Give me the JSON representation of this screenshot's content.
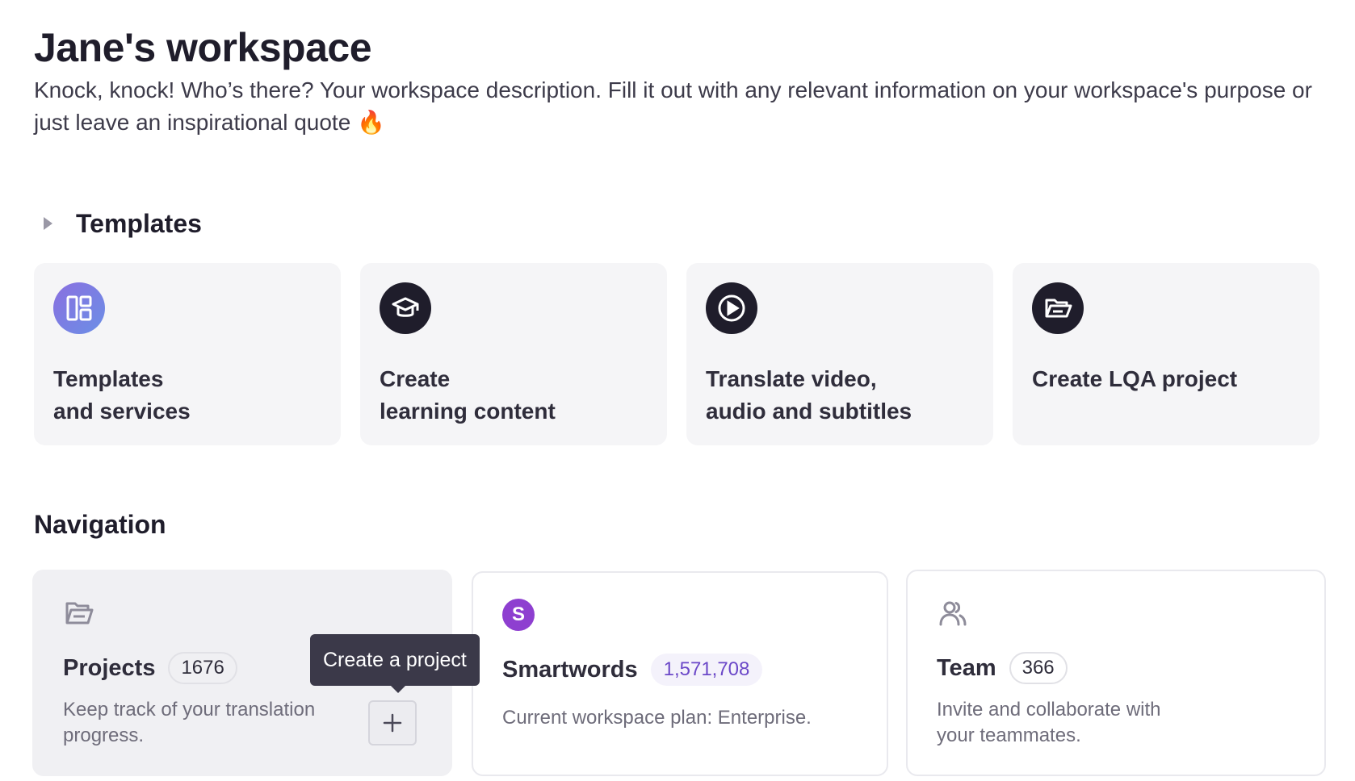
{
  "workspace": {
    "title": "Jane's workspace",
    "description": "Knock, knock! Who’s there? Your workspace description. Fill it out with any relevant information on your workspace's purpose or just leave an inspirational quote 🔥"
  },
  "templates": {
    "section_title": "Templates",
    "caret_icon": "caret-right-icon",
    "items": [
      {
        "line1": "Templates",
        "line2": "and services",
        "icon": "layout-grid-icon"
      },
      {
        "line1": "Create",
        "line2": "learning content",
        "icon": "graduation-cap-icon"
      },
      {
        "line1": "Translate video,",
        "line2": "audio and subtitles",
        "icon": "play-circle-icon"
      },
      {
        "line1": "Create LQA project",
        "line2": "",
        "icon": "folder-open-icon"
      }
    ]
  },
  "navigation": {
    "section_title": "Navigation",
    "projects": {
      "name": "Projects",
      "count": "1676",
      "desc_line1": "Keep track of your translation",
      "desc_line2": "progress.",
      "icon": "folder-open-icon",
      "add_icon": "plus-icon",
      "tooltip": "Create a project"
    },
    "smartwords": {
      "avatar_letter": "S",
      "name": "Smartwords",
      "count": "1,571,708",
      "desc": "Current workspace plan: Enterprise."
    },
    "team": {
      "name": "Team",
      "count": "366",
      "desc_line1": "Invite and collaborate with",
      "desc_line2": "your teammates.",
      "icon": "users-icon"
    }
  },
  "colors": {
    "accent_purple": "#6b48c8",
    "avatar_purple": "#8e3fd0",
    "dark": "#1f1d2b",
    "card_bg": "#f5f5f7"
  }
}
